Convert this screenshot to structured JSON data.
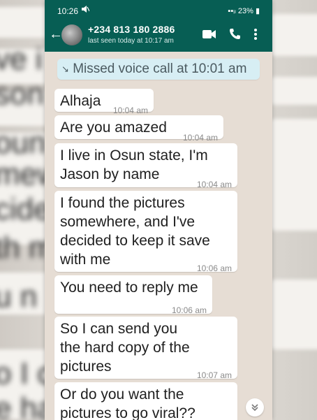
{
  "status_bar": {
    "time": "10:26",
    "battery": "23%"
  },
  "header": {
    "contact_name": "+234 813 180 2886",
    "last_seen": "last seen today at 10:17 am"
  },
  "system_message": {
    "text": "Missed voice call at 10:01 am",
    "icon": "missed-call-icon"
  },
  "messages": [
    {
      "text": "Alhaja",
      "time": "10:04 am"
    },
    {
      "text": "Are you amazed",
      "time": "10:04 am"
    },
    {
      "text": "I live in Osun state, I'm\nJason by name",
      "time": "10:04 am"
    },
    {
      "text": "I found the pictures\nsomewhere, and I've\ndecided to keep it save\nwith me",
      "time": "10:06 am"
    },
    {
      "text": "You need to reply me",
      "time": "10:06 am"
    },
    {
      "text": "So I can send you\nthe hard copy of the\npictures",
      "time": "10:07 am"
    },
    {
      "text": "Or do you want the\npictures to go viral??",
      "time": ""
    }
  ],
  "colors": {
    "header": "#075e54",
    "chat_bg": "#e6ddd4",
    "bubble": "#ffffff",
    "system_bubble": "#d7eef4"
  }
}
